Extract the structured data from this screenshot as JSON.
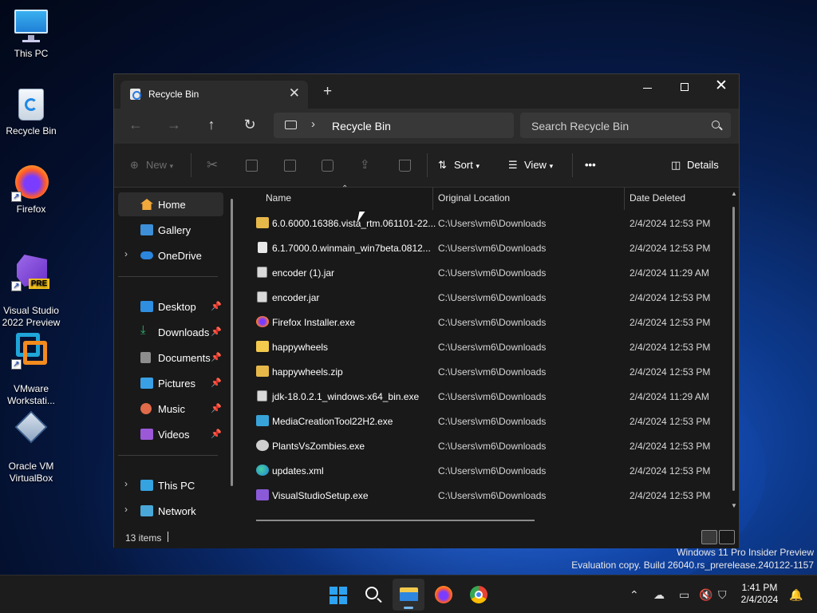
{
  "desktop": {
    "icons": [
      {
        "label": "This PC"
      },
      {
        "label": "Recycle Bin"
      },
      {
        "label": "Firefox"
      },
      {
        "label": "Visual Studio\n2022 Preview",
        "badge": "PRE"
      },
      {
        "label": "VMware\nWorkstati..."
      },
      {
        "label": "Oracle VM\nVirtualBox"
      }
    ]
  },
  "window": {
    "tab_title": "Recycle Bin",
    "address": {
      "path": "Recycle Bin"
    },
    "search": {
      "placeholder": "Search Recycle Bin"
    },
    "commands": {
      "new": "New",
      "sort": "Sort",
      "view": "View",
      "more": "•••",
      "details": "Details"
    },
    "nav": {
      "home": "Home",
      "gallery": "Gallery",
      "onedrive": "OneDrive",
      "desktop": "Desktop",
      "downloads": "Downloads",
      "documents": "Documents",
      "pictures": "Pictures",
      "music": "Music",
      "videos": "Videos",
      "thispc": "This PC",
      "network": "Network"
    },
    "columns": {
      "name": "Name",
      "location": "Original Location",
      "date": "Date Deleted"
    },
    "files": [
      {
        "name": "6.0.6000.16386.vista_rtm.061101-22...",
        "location": "C:\\Users\\vm6\\Downloads",
        "date": "2/4/2024 12:53 PM",
        "icon": "zip-folder-icon"
      },
      {
        "name": "6.1.7000.0.winmain_win7beta.0812...",
        "location": "C:\\Users\\vm6\\Downloads",
        "date": "2/4/2024 12:53 PM",
        "icon": "file-icon"
      },
      {
        "name": "encoder (1).jar",
        "location": "C:\\Users\\vm6\\Downloads",
        "date": "2/4/2024 11:29 AM",
        "icon": "jar-icon"
      },
      {
        "name": "encoder.jar",
        "location": "C:\\Users\\vm6\\Downloads",
        "date": "2/4/2024 12:53 PM",
        "icon": "jar-icon"
      },
      {
        "name": "Firefox Installer.exe",
        "location": "C:\\Users\\vm6\\Downloads",
        "date": "2/4/2024 12:53 PM",
        "icon": "firefox-installer-icon"
      },
      {
        "name": "happywheels",
        "location": "C:\\Users\\vm6\\Downloads",
        "date": "2/4/2024 12:53 PM",
        "icon": "folder-icon"
      },
      {
        "name": "happywheels.zip",
        "location": "C:\\Users\\vm6\\Downloads",
        "date": "2/4/2024 12:53 PM",
        "icon": "zip-folder-icon"
      },
      {
        "name": "jdk-18.0.2.1_windows-x64_bin.exe",
        "location": "C:\\Users\\vm6\\Downloads",
        "date": "2/4/2024 11:29 AM",
        "icon": "jdk-installer-icon"
      },
      {
        "name": "MediaCreationTool22H2.exe",
        "location": "C:\\Users\\vm6\\Downloads",
        "date": "2/4/2024 12:53 PM",
        "icon": "media-creation-tool-icon"
      },
      {
        "name": "PlantsVsZombies.exe",
        "location": "C:\\Users\\vm6\\Downloads",
        "date": "2/4/2024 12:53 PM",
        "icon": "game-exe-icon"
      },
      {
        "name": "updates.xml",
        "location": "C:\\Users\\vm6\\Downloads",
        "date": "2/4/2024 12:53 PM",
        "icon": "edge-xml-icon"
      },
      {
        "name": "VisualStudioSetup.exe",
        "location": "C:\\Users\\vm6\\Downloads",
        "date": "2/4/2024 12:53 PM",
        "icon": "visual-studio-icon"
      }
    ],
    "status": {
      "items": "13 items"
    }
  },
  "watermark": {
    "line1": "Windows 11 Pro Insider Preview",
    "line2": "Evaluation copy. Build 26040.rs_prerelease.240122-1157"
  },
  "taskbar": {
    "time": "1:41 PM",
    "date": "2/4/2024"
  },
  "colors": {
    "accent": "#76b9ed",
    "folder": "#f2c94c",
    "window_bg": "#191919"
  }
}
